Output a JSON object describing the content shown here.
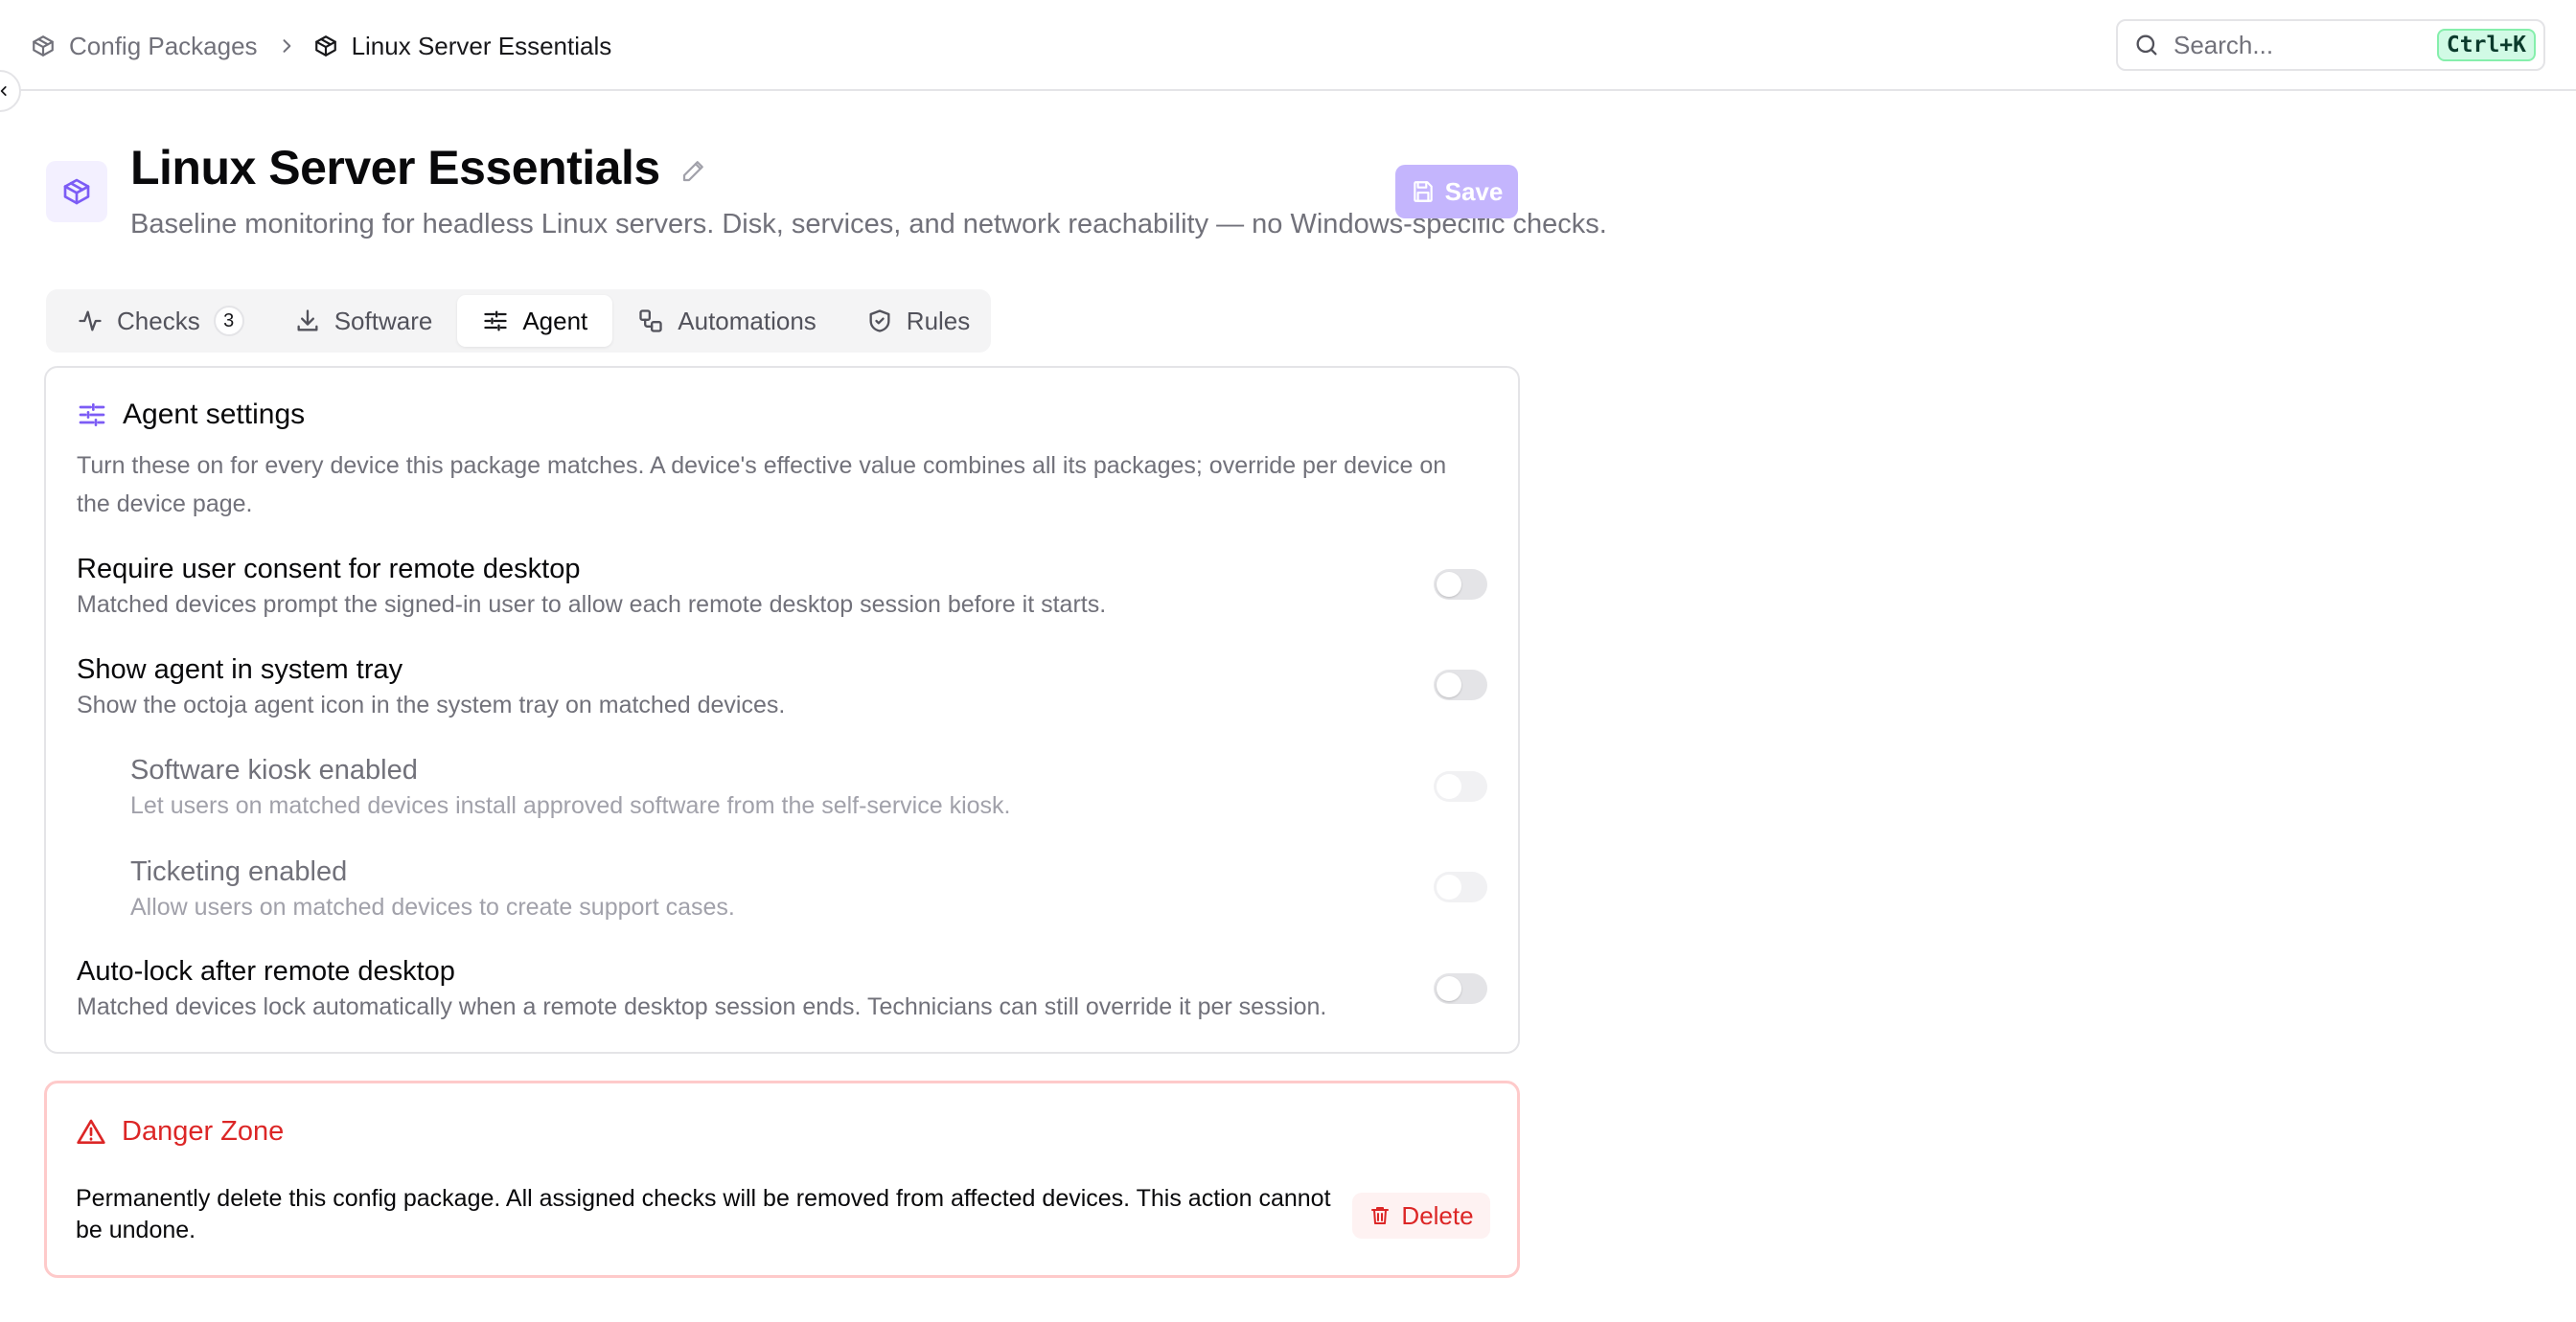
{
  "breadcrumb": {
    "parent": "Config Packages",
    "current": "Linux Server Essentials"
  },
  "search": {
    "placeholder": "Search...",
    "shortcut": "Ctrl+K"
  },
  "header": {
    "title": "Linux Server Essentials",
    "description": "Baseline monitoring for headless Linux servers. Disk, services, and network reachability — no Windows-specific checks.",
    "save_label": "Save"
  },
  "tabs": [
    {
      "label": "Checks",
      "badge": "3",
      "icon": "activity-icon",
      "active": false
    },
    {
      "label": "Software",
      "icon": "download-icon",
      "active": false
    },
    {
      "label": "Agent",
      "icon": "sliders-icon",
      "active": true
    },
    {
      "label": "Automations",
      "icon": "workflow-icon",
      "active": false
    },
    {
      "label": "Rules",
      "icon": "shield-check-icon",
      "active": false
    }
  ],
  "agent_settings": {
    "title": "Agent settings",
    "description": "Turn these on for every device this package matches. A device's effective value combines all its packages; override per device on the device page.",
    "items": [
      {
        "title": "Require user consent for remote desktop",
        "description": "Matched devices prompt the signed-in user to allow each remote desktop session before it starts.",
        "enabled": false,
        "nested": false,
        "disabled": false
      },
      {
        "title": "Show agent in system tray",
        "description": "Show the octoja agent icon in the system tray on matched devices.",
        "enabled": false,
        "nested": false,
        "disabled": false
      },
      {
        "title": "Software kiosk enabled",
        "description": "Let users on matched devices install approved software from the self-service kiosk.",
        "enabled": false,
        "nested": true,
        "disabled": true
      },
      {
        "title": "Ticketing enabled",
        "description": "Allow users on matched devices to create support cases.",
        "enabled": false,
        "nested": true,
        "disabled": true
      },
      {
        "title": "Auto-lock after remote desktop",
        "description": "Matched devices lock automatically when a remote desktop session ends. Technicians can still override it per session.",
        "enabled": false,
        "nested": false,
        "disabled": false
      }
    ]
  },
  "danger_zone": {
    "title": "Danger Zone",
    "description": "Permanently delete this config package. All assigned checks will be removed from affected devices. This action cannot be undone.",
    "delete_label": "Delete"
  },
  "colors": {
    "accent": "#7c5cf5",
    "accent_soft": "#c4b5fd",
    "danger": "#dc2626",
    "danger_border": "#fecaca"
  }
}
